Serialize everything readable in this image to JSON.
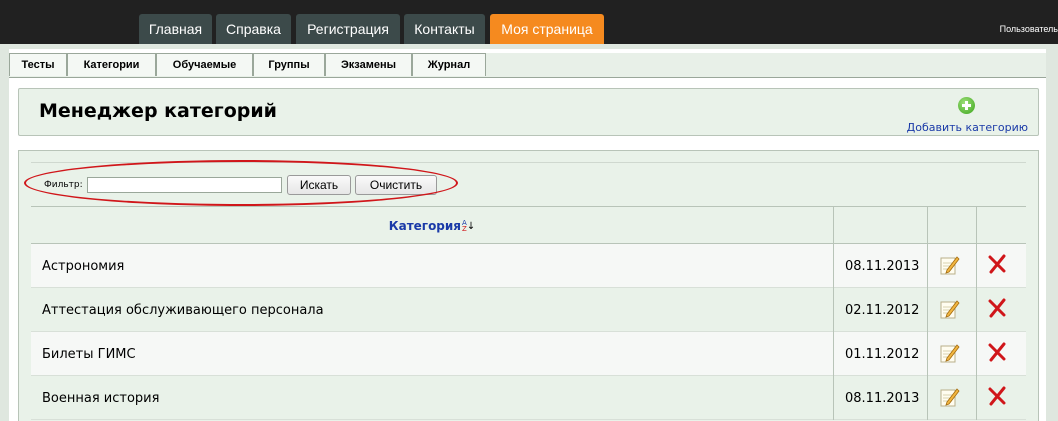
{
  "top_nav": {
    "tabs": [
      {
        "label": "Главная",
        "active": false
      },
      {
        "label": "Справка",
        "active": false
      },
      {
        "label": "Регистрация",
        "active": false
      },
      {
        "label": "Контакты",
        "active": false
      },
      {
        "label": "Моя страница",
        "active": true
      }
    ],
    "user_label": "Пользователь"
  },
  "sub_menu": {
    "items": [
      "Тесты",
      "Категории",
      "Обучаемые",
      "Группы",
      "Экзамены",
      "Журнал"
    ]
  },
  "header": {
    "title": "Менеджер категорий",
    "add_label": "Добавить категорию",
    "add_icon": "plus-circle-icon"
  },
  "filter": {
    "label": "Фильтр:",
    "value": "",
    "search_button": "Искать",
    "clear_button": "Очистить"
  },
  "table": {
    "column_category": "Категория",
    "sort_icon": "sort-az-icon",
    "rows": [
      {
        "name": "Астрономия",
        "date": "08.11.2013"
      },
      {
        "name": "Аттестация обслуживающего персонала",
        "date": "02.11.2012"
      },
      {
        "name": "Билеты ГИМС",
        "date": "01.11.2012"
      },
      {
        "name": "Военная история",
        "date": "08.11.2013"
      }
    ]
  },
  "colors": {
    "top_bar": "#212121",
    "tab": "#3c4a4a",
    "tab_active": "#f58a1f",
    "panel": "#e9f2e9",
    "link": "#1a3aa8",
    "highlight_ellipse": "#d0161a"
  }
}
